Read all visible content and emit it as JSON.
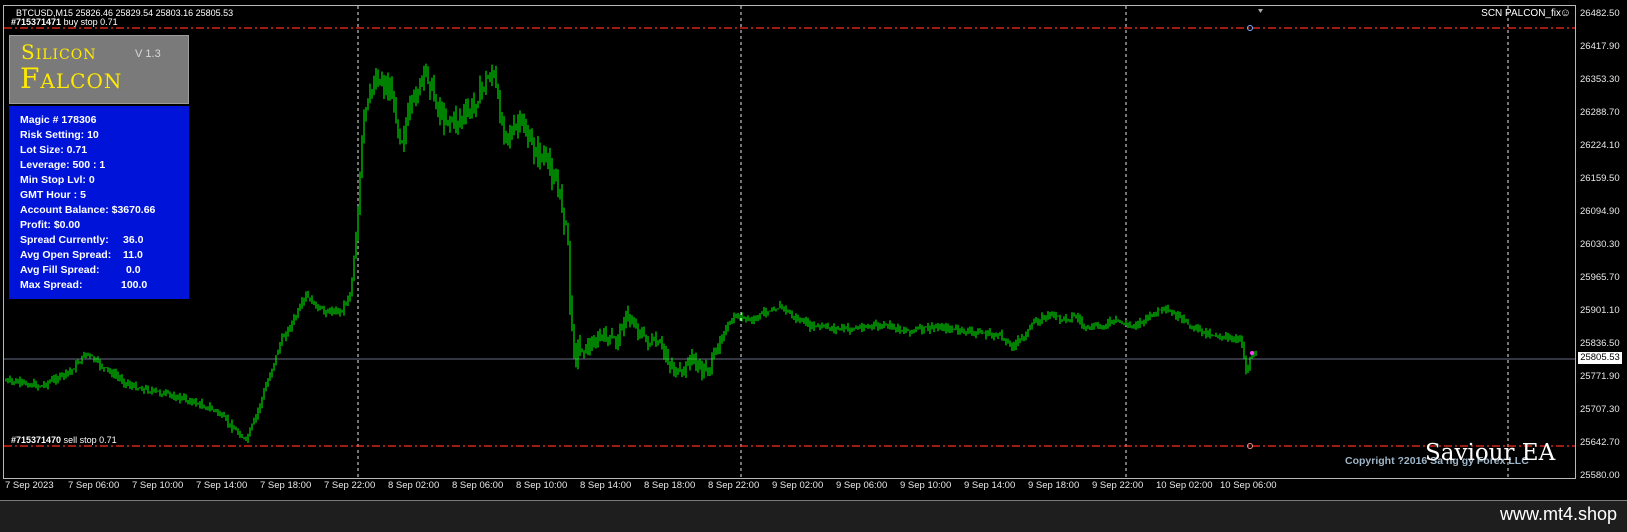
{
  "chart": {
    "symbol_info": "BTCUSD,M15  25826.46 25829.54 25803.16 25805.53",
    "indicator_name": "SCN PALCON_fix",
    "smiley_icon": "smiley-icon",
    "current_price": "25805.53",
    "price_labels": [
      "26482.50",
      "26417.90",
      "26353.30",
      "26288.70",
      "26224.10",
      "26159.50",
      "26094.90",
      "26030.30",
      "25965.70",
      "25901.10",
      "25836.50",
      "25771.90",
      "25707.30",
      "25642.70",
      "25580.00"
    ],
    "time_labels": [
      "7 Sep 2023",
      "7 Sep 06:00",
      "7 Sep 10:00",
      "7 Sep 14:00",
      "7 Sep 18:00",
      "7 Sep 22:00",
      "8 Sep 02:00",
      "8 Sep 06:00",
      "8 Sep 10:00",
      "8 Sep 14:00",
      "8 Sep 18:00",
      "8 Sep 22:00",
      "9 Sep 02:00",
      "9 Sep 06:00",
      "9 Sep 10:00",
      "9 Sep 14:00",
      "9 Sep 18:00",
      "9 Sep 22:00",
      "10 Sep 02:00",
      "10 Sep 06:00"
    ],
    "orders": {
      "buy_stop": {
        "ticket": "#715371471",
        "label": "buy stop 0.71"
      },
      "sell_stop": {
        "ticket": "#715371470",
        "label": "sell stop 0.71"
      }
    },
    "colors": {
      "candle": "#00ff00",
      "order_line": "#ff2a1a",
      "panel_blue": "#0014d9",
      "brand": "#ffea00"
    }
  },
  "panel": {
    "brand_line1": "Silicon",
    "brand_line2": "Falcon",
    "version": "V 1.3",
    "lines": [
      {
        "label": "Magic # 178306",
        "value": ""
      },
      {
        "label": "Risk Setting: 10",
        "value": ""
      },
      {
        "label": "Lot Size: 0.71",
        "value": ""
      },
      {
        "label": "Leverage: 500 : 1",
        "value": ""
      },
      {
        "label": "Min Stop Lvl: 0",
        "value": ""
      },
      {
        "label": "GMT Hour : 5",
        "value": ""
      },
      {
        "label": "Account Balance: $3670.66",
        "value": ""
      },
      {
        "label": "Profit: $0.00",
        "value": ""
      },
      {
        "label": "Spread Currently:",
        "value": "36.0"
      },
      {
        "label": "Avg Open Spread:",
        "value": "11.0"
      },
      {
        "label": "Avg Fill Spread:",
        "value": "0.0"
      },
      {
        "label": "Max Spread:",
        "value": "100.0"
      }
    ]
  },
  "footer": {
    "copyright": "Copyright ?2016 Sa    ng  gy  Forex LLC",
    "ea_name": "Saviour EA",
    "site": "www.mt4.shop"
  }
}
